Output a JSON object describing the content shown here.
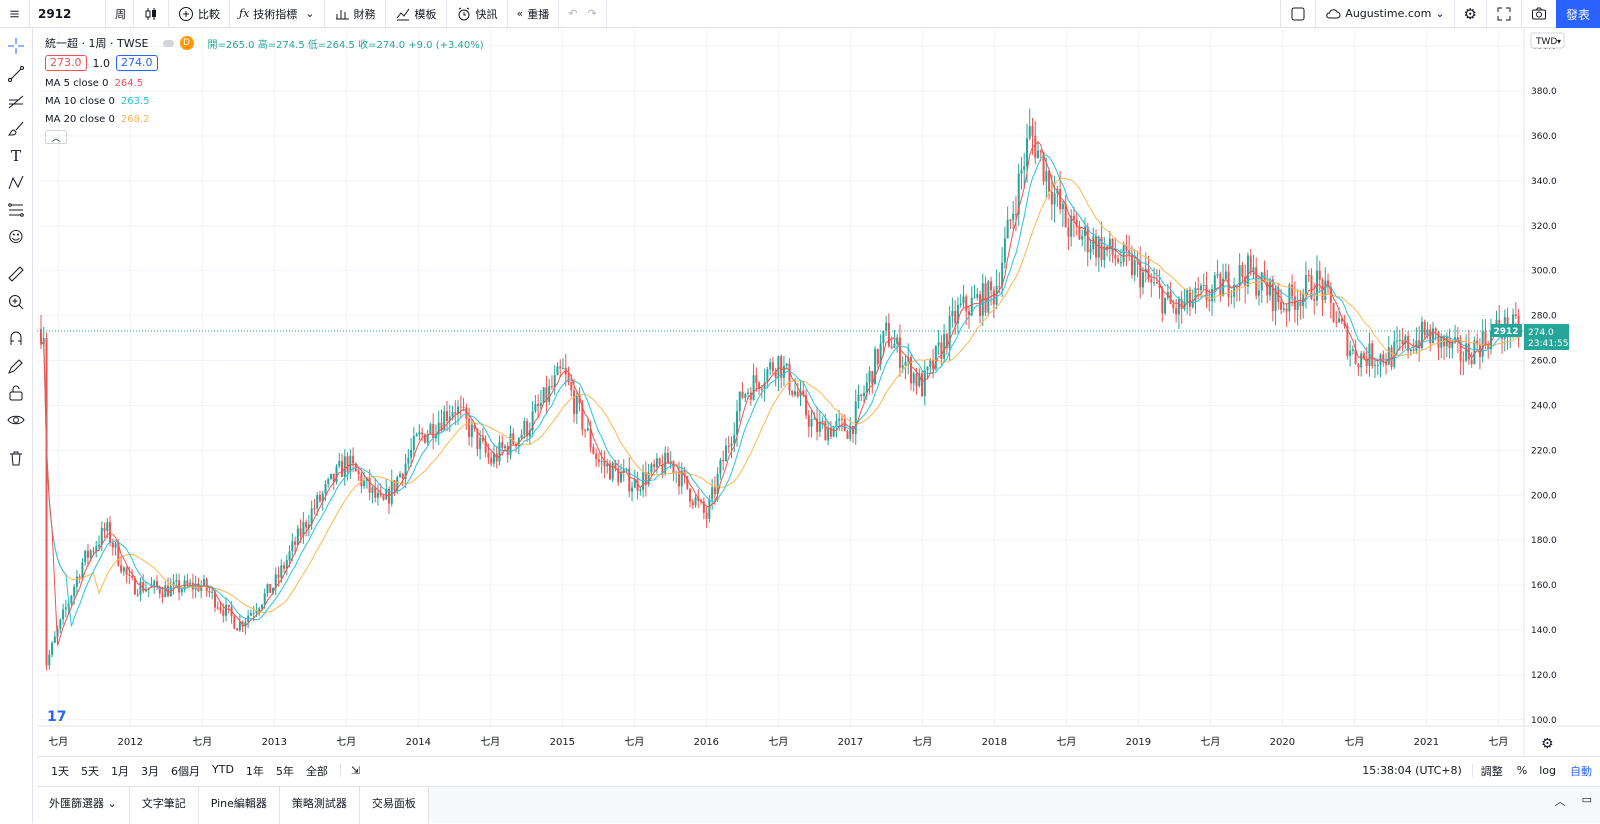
{
  "topbar": {
    "symbol": "2912",
    "interval": "周",
    "compare": "比較",
    "indicators": "技術指標",
    "financials": "財務",
    "templates": "模板",
    "alert": "快訊",
    "replay": "重播",
    "account": "Augustime.com",
    "publish": "發表"
  },
  "legend": {
    "title": "統一超 · 1周 · TWSE",
    "badge": "D",
    "ohlc": "開=265.0 高=274.5 低=264.5 收=274.0 +9.0 (+3.40%)",
    "bid": "273.0",
    "spread": "1.0",
    "ask": "274.0",
    "ma5_label": "MA 5 close 0",
    "ma5_value": "264.5",
    "ma10_label": "MA 10 close 0",
    "ma10_value": "263.5",
    "ma20_label": "MA 20 close 0",
    "ma20_value": "268.2"
  },
  "colors": {
    "up": "#26a69a",
    "down": "#ef5350",
    "ma5": "#ef5350",
    "ma10": "#26c6da",
    "ma20": "#ffb74d",
    "accent": "#2962ff"
  },
  "price_axis": {
    "currency": "TWD",
    "last_symbol": "2912",
    "last_price": "274.0",
    "countdown": "23:41:55"
  },
  "time_axis": {
    "labels": [
      "七月",
      "2012",
      "七月",
      "2013",
      "七月",
      "2014",
      "七月",
      "2015",
      "七月",
      "2016",
      "七月",
      "2017",
      "七月",
      "2018",
      "七月",
      "2019",
      "七月",
      "2020",
      "七月",
      "2021",
      "七月"
    ]
  },
  "bottombar": {
    "ranges": [
      "1天",
      "5天",
      "1月",
      "3月",
      "6個月",
      "YTD",
      "1年",
      "5年",
      "全部"
    ],
    "clock": "15:38:04 (UTC+8)",
    "adjust": "調整",
    "percent": "%",
    "log": "log",
    "auto": "自動"
  },
  "tabs": [
    "外匯篩選器",
    "文字筆記",
    "Pine編輯器",
    "策略測試器",
    "交易面板"
  ],
  "chart_data": {
    "type": "line",
    "title": "統一超 · 1周 · TWSE",
    "xlabel": "",
    "ylabel": "",
    "ylim": [
      95,
      405
    ],
    "yticks": [
      100,
      120,
      140,
      160,
      180,
      200,
      220,
      240,
      260,
      280,
      300,
      320,
      340,
      360,
      380,
      400
    ],
    "last_price": 274.0,
    "series": [
      {
        "name": "MA 20 close 0",
        "x": [
          "2011-06",
          "2011-09",
          "2012-01",
          "2012-04",
          "2012-07",
          "2012-10",
          "2013-01",
          "2013-04",
          "2013-07",
          "2013-10",
          "2014-01",
          "2014-04",
          "2014-07",
          "2014-10",
          "2015-01",
          "2015-04",
          "2015-07",
          "2015-10",
          "2016-01",
          "2016-04",
          "2016-07",
          "2016-10",
          "2017-01",
          "2017-04",
          "2017-07",
          "2017-10",
          "2018-01",
          "2018-04",
          "2018-07",
          "2018-10",
          "2019-01",
          "2019-04",
          "2019-07",
          "2019-10",
          "2020-01",
          "2020-04",
          "2020-07",
          "2020-10",
          "2021-01",
          "2021-04",
          "2021-07"
        ],
        "values": [
          126,
          150,
          165,
          162,
          158,
          160,
          152,
          155,
          178,
          210,
          205,
          215,
          240,
          232,
          238,
          232,
          218,
          210,
          208,
          230,
          255,
          245,
          230,
          262,
          258,
          272,
          282,
          295,
          325,
          335,
          322,
          305,
          300,
          298,
          305,
          290,
          300,
          275,
          272,
          270,
          268
        ]
      },
      {
        "name": "close",
        "x": [
          "2011-06",
          "2011-09",
          "2011-11",
          "2012-01",
          "2012-04",
          "2012-07",
          "2012-10",
          "2013-01",
          "2013-04",
          "2013-07",
          "2013-10",
          "2014-01",
          "2014-04",
          "2014-07",
          "2014-10",
          "2015-01",
          "2015-04",
          "2015-07",
          "2015-10",
          "2016-01",
          "2016-04",
          "2016-07",
          "2016-10",
          "2017-01",
          "2017-04",
          "2017-07",
          "2017-10",
          "2018-01",
          "2018-04",
          "2018-07",
          "2018-10",
          "2019-01",
          "2019-04",
          "2019-07",
          "2019-10",
          "2020-01",
          "2020-04",
          "2020-07",
          "2020-10",
          "2021-01",
          "2021-04",
          "2021-07"
        ],
        "values": [
          125,
          170,
          185,
          160,
          158,
          160,
          142,
          160,
          192,
          215,
          195,
          225,
          240,
          215,
          230,
          255,
          215,
          205,
          215,
          190,
          245,
          260,
          230,
          230,
          272,
          248,
          282,
          290,
          362,
          320,
          310,
          300,
          282,
          290,
          300,
          285,
          295,
          262,
          262,
          272,
          262,
          274
        ]
      }
    ]
  }
}
